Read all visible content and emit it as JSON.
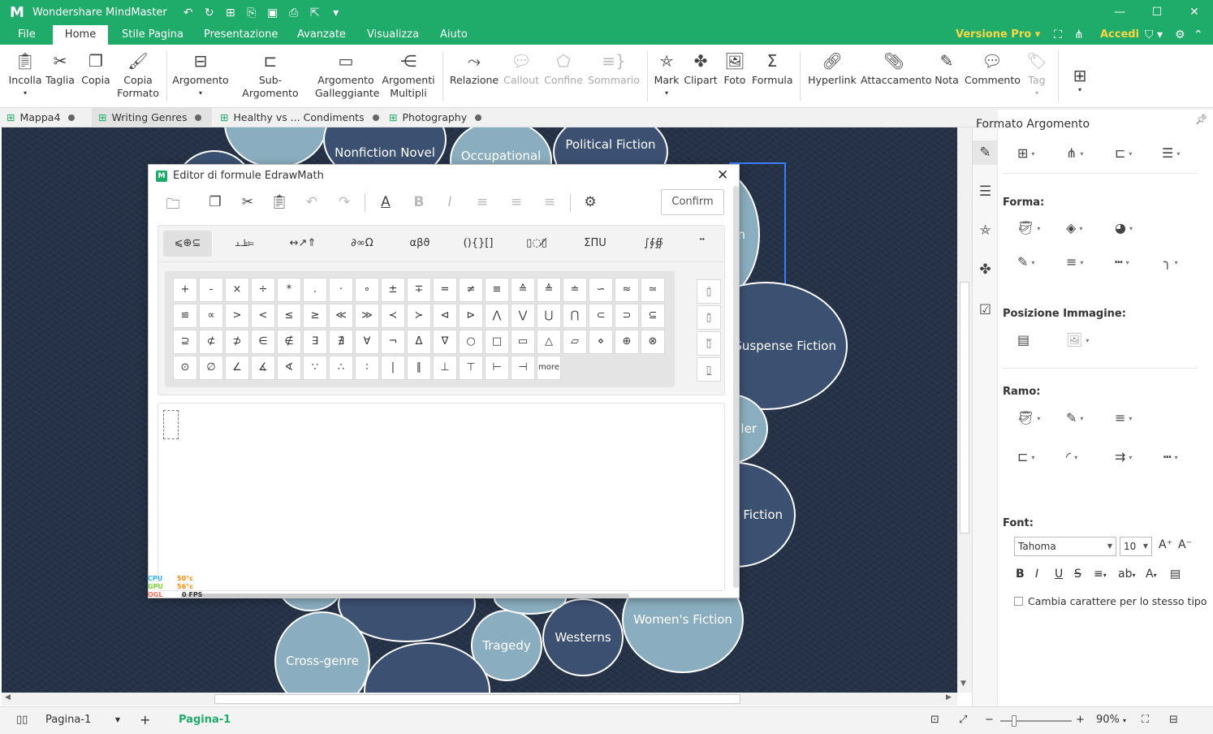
{
  "titlebar": {
    "app_title": "Wondershare MindMaster",
    "quick_icons": [
      "undo-icon",
      "redo-icon",
      "new-icon",
      "open-icon",
      "save-icon",
      "print-icon",
      "export-icon",
      "more-icon"
    ],
    "window_controls": [
      "minimize",
      "maximize",
      "close"
    ]
  },
  "menu": {
    "items": [
      "File",
      "Home",
      "Stile Pagina",
      "Presentazione",
      "Avanzate",
      "Visualizza",
      "Aiuto"
    ],
    "active": "Home",
    "version": "Versione Pro",
    "login": "Accedi"
  },
  "ribbon": {
    "incolla": "Incolla",
    "taglia": "Taglia",
    "copia": "Copia",
    "copia_formato_1": "Copia",
    "copia_formato_2": "Formato",
    "argomento": "Argomento",
    "sub_argomento": "Sub-Argomento",
    "gall_1": "Argomento",
    "gall_2": "Galleggiante",
    "mult_1": "Argomenti",
    "mult_2": "Multipli",
    "relazione": "Relazione",
    "callout": "Callout",
    "confine": "Confine",
    "sommario": "Sommario",
    "mark": "Mark",
    "clipart": "Clipart",
    "foto": "Foto",
    "formula": "Formula",
    "hyperlink": "Hyperlink",
    "attaccamento": "Attaccamento",
    "nota": "Nota",
    "commento": "Commento",
    "tag": "Tag"
  },
  "doc_tabs": [
    "Mappa4",
    "Writing Genres",
    "Healthy vs ... Condiments",
    "Photography"
  ],
  "doc_tab_active": "Writing Genres",
  "canvas": {
    "bubbles": {
      "nonfiction_novel": "Nonfiction Novel",
      "occupational": "Occupational",
      "political_fiction": "Political Fiction",
      "fiction_partial": "ction",
      "suspense_fiction": "Suspense Fiction",
      "thriller_partial": "ller",
      "fiction2_partial": "Fiction",
      "womens_fiction": "Women's Fiction",
      "westerns": "Westerns",
      "tragedy": "Tragedy",
      "cross_genre": "Cross-genre"
    }
  },
  "dialog": {
    "title": "Editor di formule EdrawMath",
    "confirm": "Confirm",
    "categories": [
      "⩽⊕⊆",
      "⫠⫡⫢",
      "↔↗⇑",
      "∂∞Ω",
      "αβϑ",
      "(){}[]",
      "▯◌▯̸",
      "ΣΠU",
      "∫∮∯",
      "⃗⃡⃐"
    ],
    "symbols": [
      [
        "+",
        "-",
        "×",
        "÷",
        "*",
        ".",
        "·",
        "∘",
        "±",
        "∓",
        "=",
        "≠",
        "≡",
        "≙",
        "≜",
        "≐",
        "∽",
        "≈",
        "≃"
      ],
      [
        "≌",
        "∝",
        ">",
        "<",
        "≤",
        "≥",
        "≪",
        "≫",
        "≺",
        "≻",
        "⊲",
        "⊳",
        "⋀",
        "⋁",
        "⋃",
        "⋂",
        "⊂",
        "⊃",
        "⊆"
      ],
      [
        "⊇",
        "⊄",
        "⊅",
        "∈",
        "∉",
        "∃",
        "∄",
        "∀",
        "¬",
        "Δ",
        "∇",
        "○",
        "□",
        "▭",
        "△",
        "▱",
        "⋄",
        "⊕",
        "⊗"
      ],
      [
        "⊙",
        "∅",
        "∠",
        "∡",
        "∢",
        "∵",
        "∴",
        "∶",
        "|",
        "∥",
        "⊥",
        "⊤",
        "⊢",
        "⊣",
        "more"
      ]
    ],
    "side_buttons": [
      "▯̇",
      "▯̄",
      "▯̅",
      "▯̲"
    ],
    "hw_monitor": [
      "CPU",
      "GPU",
      "OGL",
      "50°c",
      "56°c",
      "0 FPS"
    ]
  },
  "panel": {
    "title": "Formato Argomento",
    "forma": "Forma:",
    "posizione": "Posizione Immagine:",
    "ramo": "Ramo:",
    "font": "Font:",
    "font_family": "Tahoma",
    "font_size": "10",
    "same_type": "Cambia carattere per lo stesso tipo"
  },
  "status": {
    "page_select": "Pagina-1",
    "page_tab": "Pagina-1",
    "zoom": "90%"
  },
  "colors": {
    "brand": "#1fab6a",
    "pro": "#f9d648",
    "bubble_light": "#8aaebf",
    "bubble_dark": "#3c5071",
    "canvas_bg": "#253247"
  }
}
